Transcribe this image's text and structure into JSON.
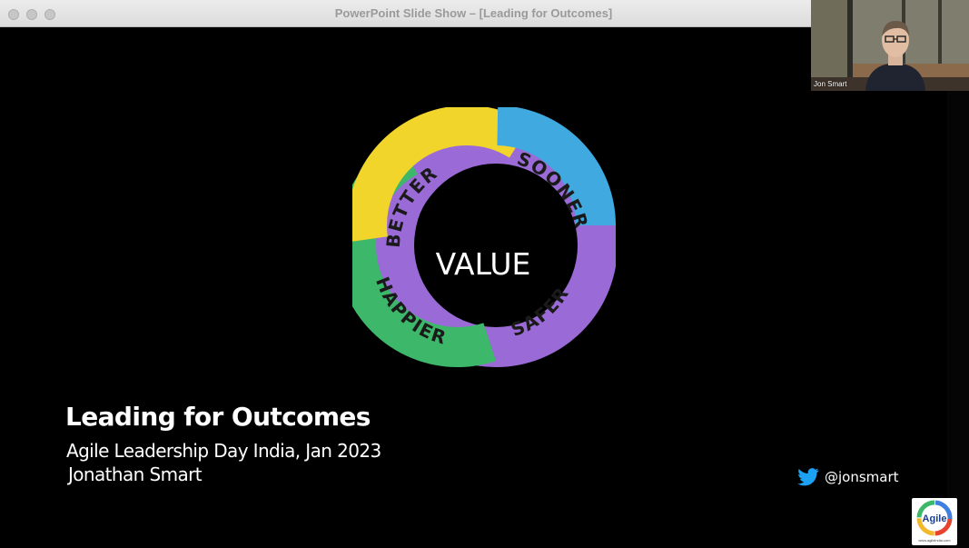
{
  "window": {
    "title": "PowerPoint Slide Show – [Leading for Outcomes]"
  },
  "slide": {
    "ring": {
      "center_label": "VALUE",
      "segments": [
        {
          "label": "BETTER",
          "color": "#f2d52a"
        },
        {
          "label": "SOONER",
          "color": "#3fa9e0"
        },
        {
          "label": "SAFER",
          "color": "#9a6ad6"
        },
        {
          "label": "HAPPIER",
          "color": "#3db86a"
        }
      ]
    },
    "title": "Leading for Outcomes",
    "subtitle": "Agile Leadership Day India, Jan 2023",
    "author": "Jonathan Smart",
    "twitter": {
      "icon": "twitter-bird-icon",
      "handle": "@jonsmart",
      "color": "#1da1f2"
    },
    "logo": {
      "text": "Agile",
      "footer": "www.agileindia.com"
    }
  },
  "video": {
    "participant_name": "Jon Smart"
  }
}
